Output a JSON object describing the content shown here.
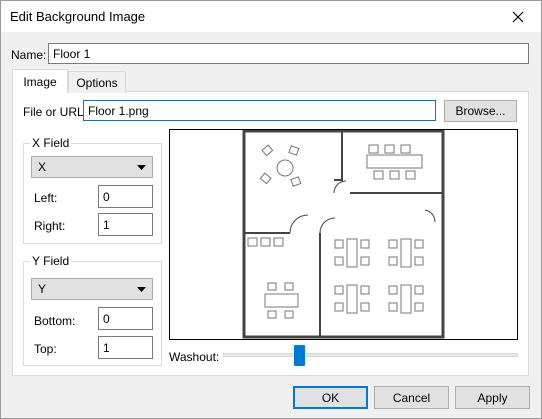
{
  "window": {
    "title": "Edit Background Image"
  },
  "name": {
    "label": "Name:",
    "value": "Floor 1"
  },
  "tabs": [
    {
      "label": "Image",
      "active": true
    },
    {
      "label": "Options",
      "active": false
    }
  ],
  "file": {
    "label": "File or URL:",
    "value": "Floor 1.png",
    "browse_label": "Browse..."
  },
  "x_field": {
    "title": "X Field",
    "select_value": "X",
    "left_label": "Left:",
    "left_value": "0",
    "right_label": "Right:",
    "right_value": "1"
  },
  "y_field": {
    "title": "Y Field",
    "select_value": "Y",
    "bottom_label": "Bottom:",
    "bottom_value": "0",
    "top_label": "Top:",
    "top_value": "1"
  },
  "washout": {
    "label": "Washout:",
    "level": 0.25
  },
  "footer": {
    "ok_label": "OK",
    "cancel_label": "Cancel",
    "apply_label": "Apply"
  },
  "colors": {
    "accent": "#0078d7",
    "panel": "#ffffff",
    "chrome": "#f0f0f0"
  }
}
